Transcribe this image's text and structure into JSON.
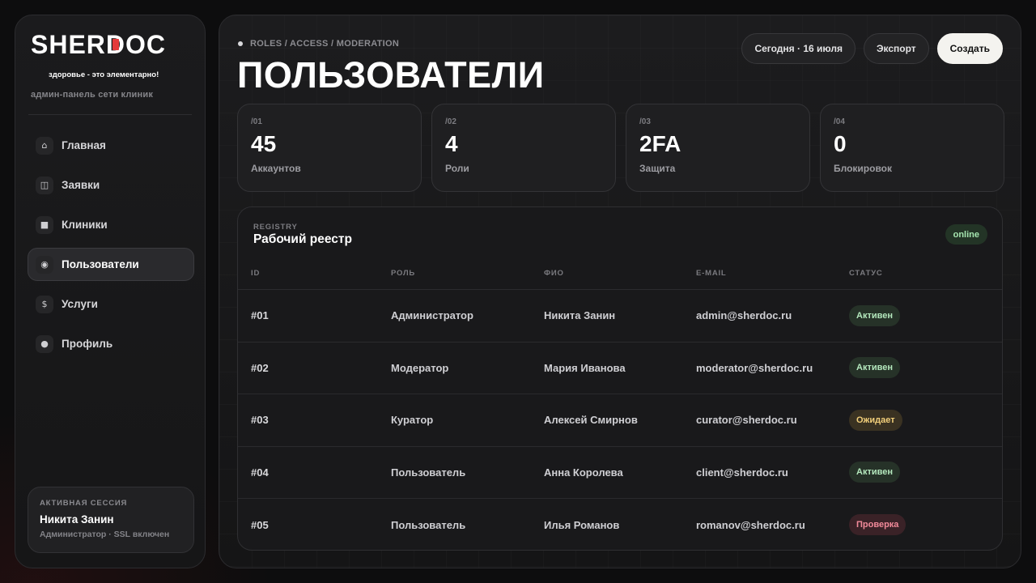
{
  "brand": {
    "logo_text": "SHERDOC",
    "tagline": "здоровье - это элементарно!",
    "subtitle": "админ-панель сети клиник"
  },
  "nav": {
    "items": [
      {
        "label": "Главная",
        "icon": "home-icon",
        "glyph": "⌂",
        "active": false
      },
      {
        "label": "Заявки",
        "icon": "requests-icon",
        "glyph": "◫",
        "active": false
      },
      {
        "label": "Клиники",
        "icon": "clinic-icon",
        "glyph": "■",
        "active": false
      },
      {
        "label": "Пользователи",
        "icon": "users-icon",
        "glyph": "◉",
        "active": true
      },
      {
        "label": "Услуги",
        "icon": "dollar-icon",
        "glyph": "$",
        "active": false
      },
      {
        "label": "Профиль",
        "icon": "profile-icon",
        "glyph": "●",
        "active": false
      }
    ]
  },
  "session": {
    "kicker": "АКТИВНАЯ СЕССИЯ",
    "name": "Никита Занин",
    "meta": "Администратор · SSL включен"
  },
  "header": {
    "breadcrumb": "ROLES / ACCESS / MODERATION",
    "title": "ПОЛЬЗОВАТЕЛИ",
    "date_label": "Сегодня · 16 июля",
    "export_label": "Экспорт",
    "create_label": "Создать"
  },
  "stats": [
    {
      "index": "/01",
      "value": "45",
      "label": "Аккаунтов"
    },
    {
      "index": "/02",
      "value": "4",
      "label": "Роли"
    },
    {
      "index": "/03",
      "value": "2FA",
      "label": "Защита"
    },
    {
      "index": "/04",
      "value": "0",
      "label": "Блокировок"
    }
  ],
  "registry": {
    "kicker": "REGISTRY",
    "title": "Рабочий реестр",
    "badge": "online",
    "columns": [
      "ID",
      "РОЛЬ",
      "ФИО",
      "E-MAIL",
      "СТАТУС"
    ],
    "rows": [
      {
        "id": "#01",
        "role": "Администратор",
        "name": "Никита Занин",
        "email": "admin@sherdoc.ru",
        "status": "Активен",
        "status_kind": "active"
      },
      {
        "id": "#02",
        "role": "Модератор",
        "name": "Мария Иванова",
        "email": "moderator@sherdoc.ru",
        "status": "Активен",
        "status_kind": "active"
      },
      {
        "id": "#03",
        "role": "Куратор",
        "name": "Алексей Смирнов",
        "email": "curator@sherdoc.ru",
        "status": "Ожидает",
        "status_kind": "pending"
      },
      {
        "id": "#04",
        "role": "Пользователь",
        "name": "Анна Королева",
        "email": "client@sherdoc.ru",
        "status": "Активен",
        "status_kind": "active"
      },
      {
        "id": "#05",
        "role": "Пользователь",
        "name": "Илья Романов",
        "email": "romanov@sherdoc.ru",
        "status": "Проверка",
        "status_kind": "review"
      }
    ]
  },
  "colors": {
    "accent_red": "#e43a3a",
    "status_active": "#b4e8bd",
    "status_pending": "#f2cf7a",
    "status_review": "#f28a9a",
    "primary_button": "#f4f3ef"
  }
}
